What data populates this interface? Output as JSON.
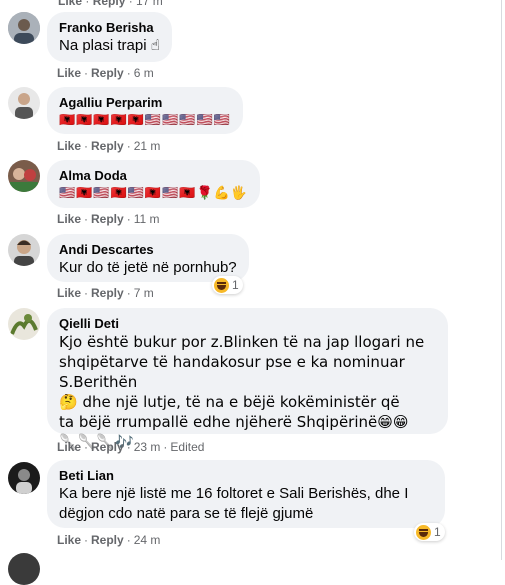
{
  "labels": {
    "like": "Like",
    "reply": "Reply"
  },
  "top_stub": {
    "time": "17 m"
  },
  "comments": [
    {
      "author": "Franko Berisha",
      "text": "Na plasi trapi ☝",
      "time": "6 m",
      "edited": "",
      "reactions": ""
    },
    {
      "author": "Agalliu Perparim",
      "text": "🇦🇱🇦🇱🇦🇱🇦🇱🇦🇱🇺🇸🇺🇸🇺🇸🇺🇸🇺🇸",
      "time": "21 m",
      "edited": "",
      "reactions": ""
    },
    {
      "author": "Alma Doda",
      "text": "🇺🇸🇦🇱🇺🇸🇦🇱🇺🇸🇦🇱🇺🇸🇦🇱🌹💪🖐",
      "time": "11 m",
      "edited": "",
      "reactions": ""
    },
    {
      "author": "Andi Descartes",
      "text": "Kur do të jetë në pornhub?",
      "time": "7 m",
      "edited": "",
      "reactions": "1"
    },
    {
      "author": "Qielli Deti",
      "text": "Kjo është bukur por z.Blinken të na jap llogari ne\nshqipëtarve të handakosur pse e ka nominuar S.Berithën\n🤔 dhe një lutje, të na e bëjë kokëministër që\nta bëjë rrumpallë edhe njëherë Shqipërinë😁😁\n🥄🥄🥄🎶",
      "time": "23 m",
      "edited": "Edited",
      "reactions": ""
    },
    {
      "author": "Beti Lian",
      "text": "Ka bere një listë me 16 foltoret e Sali Berishës, dhe I\ndëgjon cdo natë para se të flejë gjumë",
      "time": "24 m",
      "edited": "",
      "reactions": "1"
    }
  ],
  "colors": {
    "bubble": "#f0f2f5",
    "meta": "#65676b",
    "text": "#050505",
    "haha": "#f7b928"
  }
}
